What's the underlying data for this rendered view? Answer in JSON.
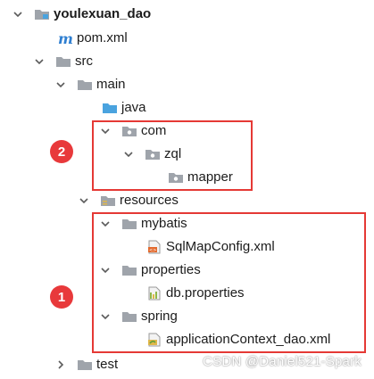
{
  "tree": {
    "root": "youlexuan_dao",
    "pom": "pom.xml",
    "src": "src",
    "main": "main",
    "java": "java",
    "com": "com",
    "zql": "zql",
    "mapper": "mapper",
    "resources": "resources",
    "mybatis": "mybatis",
    "sqlmap": "SqlMapConfig.xml",
    "properties": "properties",
    "db": "db.properties",
    "spring": "spring",
    "appctx": "applicationContext_dao.xml",
    "test": "test"
  },
  "badges": {
    "one": "1",
    "two": "2"
  },
  "watermark": "CSDN @Daniel521-Spark",
  "colors": {
    "highlight": "#e53935",
    "badge": "#e8393b",
    "folder": "#9fa4ab",
    "source_folder": "#4aa3df",
    "maven_icon": "#2f7fd1"
  }
}
